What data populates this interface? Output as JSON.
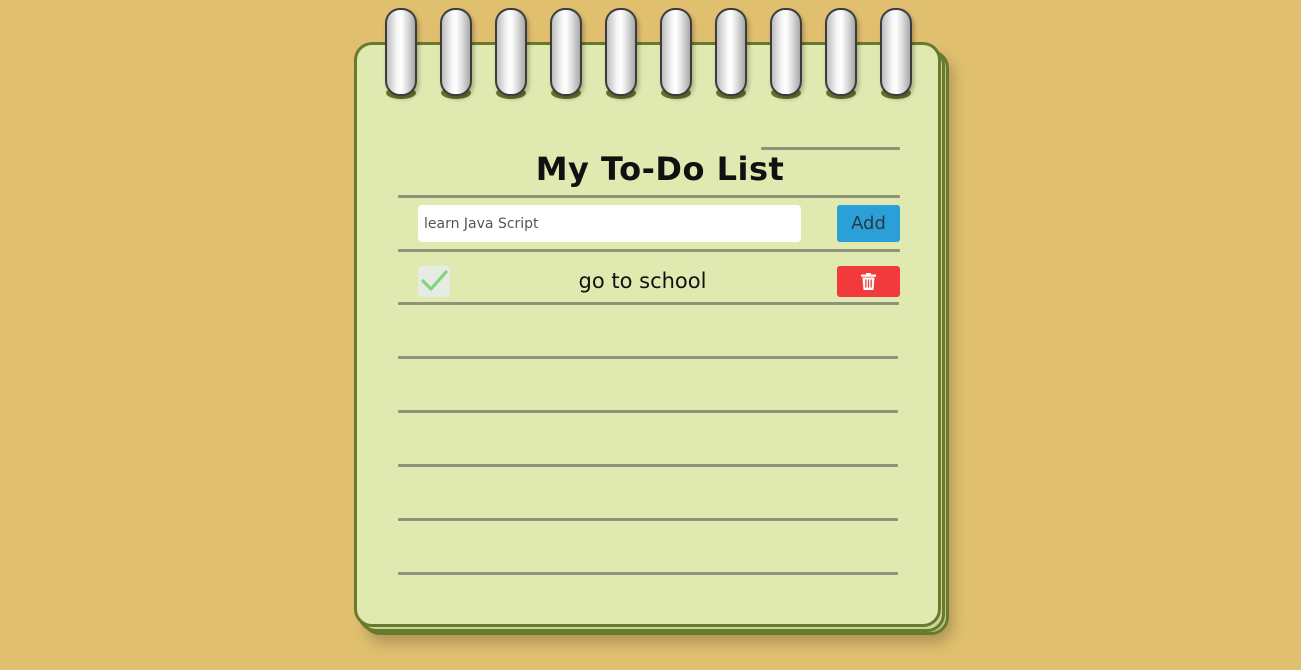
{
  "app": {
    "title": "My To-Do List"
  },
  "new_task": {
    "value": "",
    "placeholder": "learn Java Script",
    "add_label": "Add"
  },
  "tasks": [
    {
      "text": "go to school",
      "done": true
    }
  ],
  "icons": {
    "check": "check-icon",
    "delete": "trash-icon"
  },
  "colors": {
    "background": "#e0bf6f",
    "paper": "#dfe9b0",
    "paper_border": "#6a7a2c",
    "add_button": "#2a9fd8",
    "delete_button": "#f2393b",
    "check_mark": "#7ed67c"
  }
}
